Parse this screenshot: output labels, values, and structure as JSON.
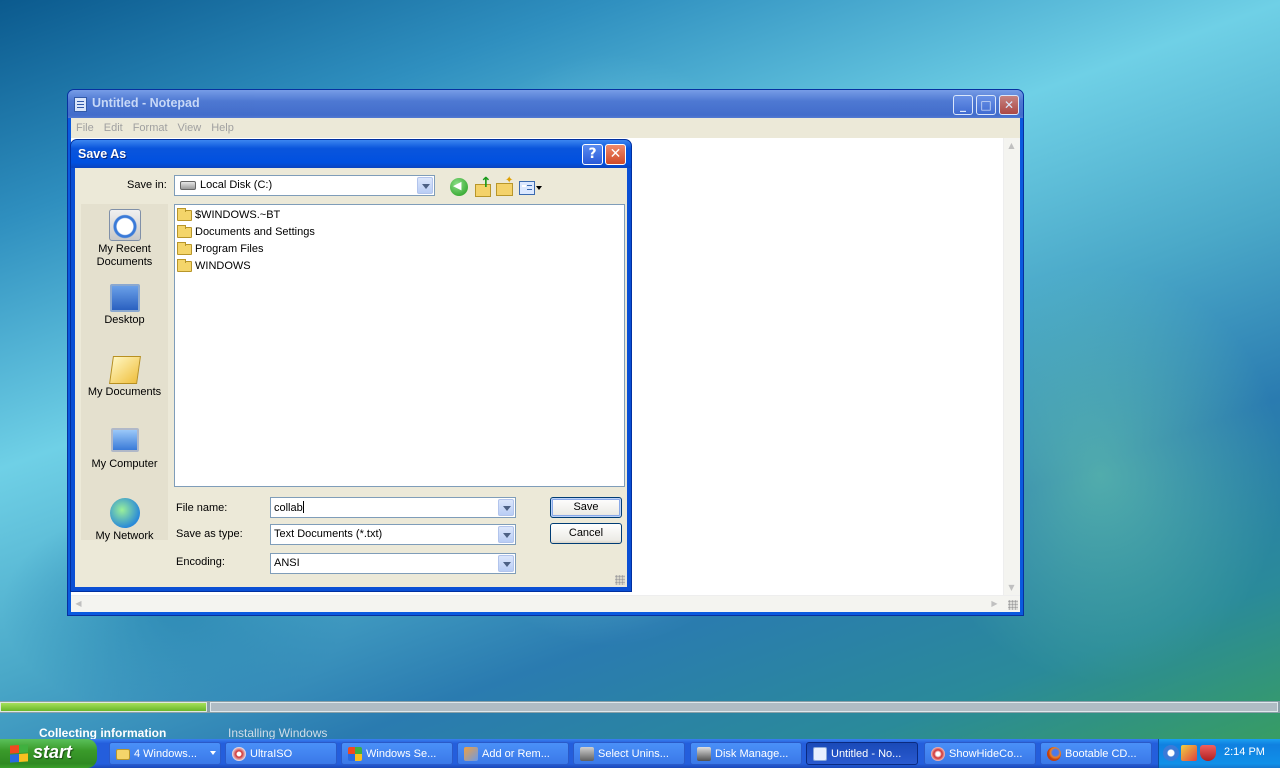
{
  "notepad": {
    "title": "Untitled - Notepad",
    "menu": [
      "File",
      "Edit",
      "Format",
      "View",
      "Help"
    ]
  },
  "dialog": {
    "title": "Save As",
    "save_in_label": "Save in:",
    "save_in_value": "Local Disk (C:)",
    "places": [
      {
        "label": "My Recent Documents",
        "icon": "recent-documents-icon"
      },
      {
        "label": "Desktop",
        "icon": "desktop-icon"
      },
      {
        "label": "My Documents",
        "icon": "my-documents-icon"
      },
      {
        "label": "My Computer",
        "icon": "my-computer-icon"
      },
      {
        "label": "My Network",
        "icon": "my-network-icon"
      }
    ],
    "files": [
      "$WINDOWS.~BT",
      "Documents and Settings",
      "Program Files",
      "WINDOWS"
    ],
    "file_name_label": "File name:",
    "file_name_value": "collab",
    "save_as_type_label": "Save as type:",
    "save_as_type_value": "Text Documents (*.txt)",
    "encoding_label": "Encoding:",
    "encoding_value": "ANSI",
    "save_button": "Save",
    "cancel_button": "Cancel"
  },
  "setup": {
    "step1": "Collecting information",
    "step2": "Installing Windows",
    "progress": 0.16
  },
  "taskbar": {
    "start_label": "start",
    "tasks": [
      {
        "label": "4 Windows...",
        "icon": "folder-icon",
        "grouped": true
      },
      {
        "label": "UltraISO",
        "icon": "ultraiso-icon"
      },
      {
        "label": "Windows Se...",
        "icon": "windows-setup-icon"
      },
      {
        "label": "Add or Rem...",
        "icon": "add-remove-programs-icon"
      },
      {
        "label": "Select Unins...",
        "icon": "uninstall-icon"
      },
      {
        "label": "Disk Manage...",
        "icon": "disk-management-icon"
      },
      {
        "label": "Untitled - No...",
        "icon": "notepad-icon",
        "active": true
      },
      {
        "label": "ShowHideCo...",
        "icon": "showhide-icon"
      },
      {
        "label": "Bootable CD...",
        "icon": "firefox-icon"
      }
    ],
    "clock": "2:14 PM"
  },
  "colors": {
    "xp_blue": "#0a55dc",
    "start_green": "#3a9a2a",
    "dialog_face": "#ece9d8"
  }
}
